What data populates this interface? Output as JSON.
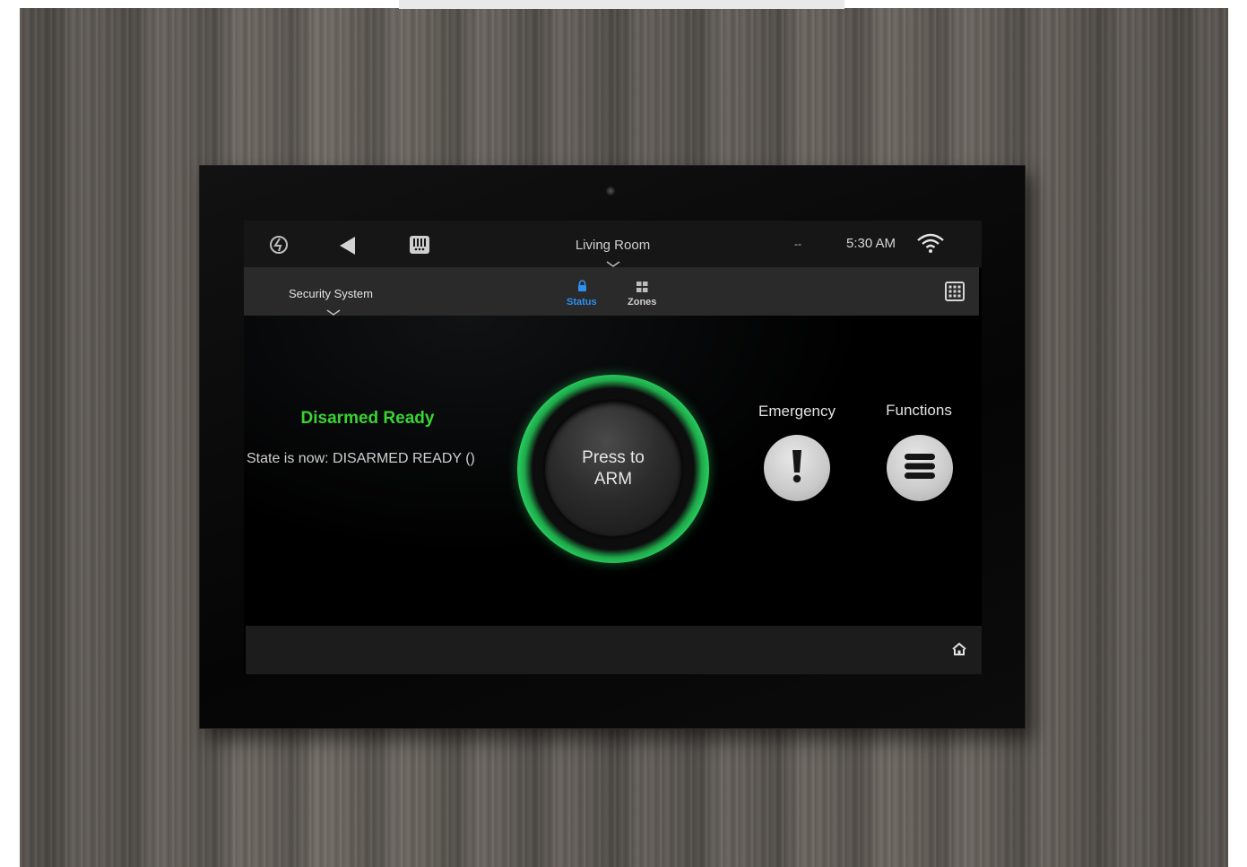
{
  "header": {
    "room": "Living Room",
    "status_dash": "--",
    "time": "5:30 AM"
  },
  "subheader": {
    "system": "Security System",
    "tabs": [
      {
        "label": "Status",
        "active": true,
        "icon": "lock-icon",
        "color": "#2d8ff0"
      },
      {
        "label": "Zones",
        "active": false,
        "icon": "grid-icon",
        "color": "#cfcfcf"
      }
    ]
  },
  "security": {
    "status_title": "Disarmed Ready",
    "status_color": "#39d434",
    "state_text": "State is now: DISARMED READY ()",
    "arm_button": {
      "line1": "Press to",
      "line2": "ARM"
    }
  },
  "actions": {
    "emergency_label": "Emergency",
    "functions_label": "Functions"
  },
  "icons": [
    "control4-logo-icon",
    "back-icon",
    "intercom-icon",
    "wifi-icon",
    "keypad-icon",
    "home-icon"
  ]
}
